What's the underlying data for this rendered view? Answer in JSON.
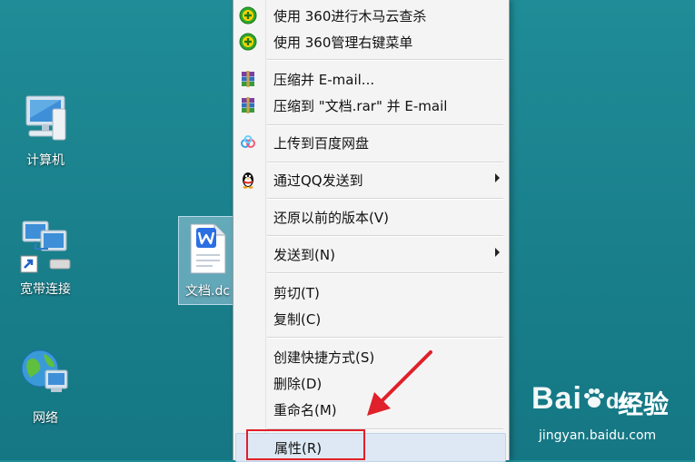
{
  "desktop": {
    "icons": [
      {
        "label": "计算机"
      },
      {
        "label": "宽带连接"
      },
      {
        "label": "网络"
      }
    ],
    "selected_file": {
      "label": "文档.dc"
    }
  },
  "context_menu": {
    "items": [
      {
        "label": "使用 360进行木马云查杀",
        "icon": "360-shield-icon"
      },
      {
        "label": "使用 360管理右键菜单",
        "icon": "360-shield-icon"
      },
      {
        "label": "压缩并 E-mail...",
        "icon": "winrar-icon"
      },
      {
        "label": "压缩到 \"文档.rar\" 并 E-mail",
        "icon": "winrar-icon"
      },
      {
        "label": "上传到百度网盘",
        "icon": "baidu-netdisk-icon"
      },
      {
        "label": "通过QQ发送到",
        "icon": "qq-penguin-icon",
        "submenu": true
      },
      {
        "label": "还原以前的版本(V)"
      },
      {
        "label": "发送到(N)",
        "submenu": true
      },
      {
        "label": "剪切(T)"
      },
      {
        "label": "复制(C)"
      },
      {
        "label": "创建快捷方式(S)"
      },
      {
        "label": "删除(D)"
      },
      {
        "label": "重命名(M)"
      },
      {
        "label": "属性(R)",
        "highlighted": true
      }
    ]
  },
  "annotation": {
    "arrow_color": "#e0202a",
    "box_color": "#e0202a"
  },
  "watermark": {
    "brand": "Bai",
    "brand_suffix": "du",
    "cn": "经验",
    "url": "jingyan.baidu.com"
  }
}
